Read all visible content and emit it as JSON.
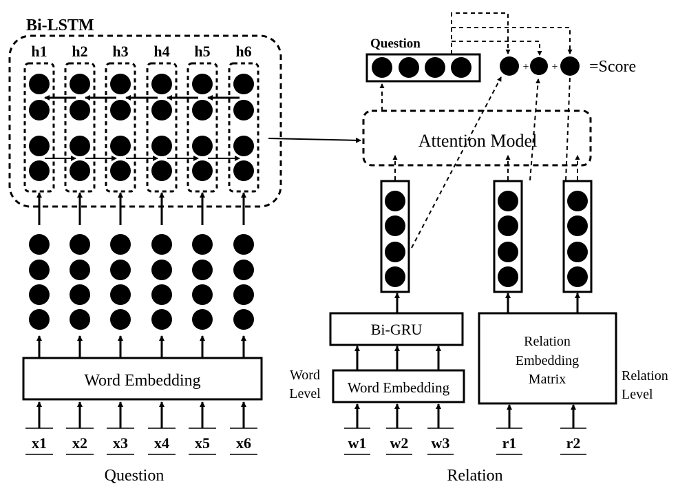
{
  "diagram": {
    "left": {
      "bilstm_title": "Bi-LSTM",
      "hidden_labels": [
        "h1",
        "h2",
        "h3",
        "h4",
        "h5",
        "h6"
      ],
      "word_embedding_label": "Word Embedding",
      "input_labels": [
        "x1",
        "x2",
        "x3",
        "x4",
        "x5",
        "x6"
      ],
      "caption": "Question"
    },
    "right": {
      "question_vector_label": "Question",
      "score_label": "=Score",
      "plus_signs": [
        "+",
        "+"
      ],
      "attention_label": "Attention Model",
      "bigru_label": "Bi-GRU",
      "word_embedding_label": "Word Embedding",
      "word_level_label": [
        "Word",
        "Level"
      ],
      "relation_matrix_label": [
        "Relation",
        "Embedding",
        "Matrix"
      ],
      "relation_level_label": [
        "Relation",
        "Level"
      ],
      "word_inputs": [
        "w1",
        "w2",
        "w3"
      ],
      "relation_inputs": [
        "r1",
        "r2"
      ],
      "caption": "Relation"
    }
  }
}
